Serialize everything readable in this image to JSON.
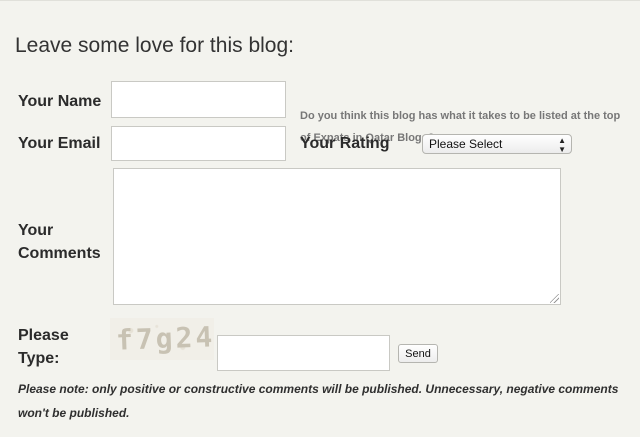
{
  "form": {
    "heading": "Leave some love for this blog:",
    "name": {
      "label": "Your Name",
      "value": ""
    },
    "email": {
      "label": "Your Email",
      "value": ""
    },
    "question": "Do you think this blog has what it takes to be listed at the top of Expats in Qatar Blogs?",
    "rating": {
      "label": "Your Rating",
      "selected": "Please Select"
    },
    "comments": {
      "label_line1": "Your",
      "label_line2": "Comments",
      "value": ""
    },
    "captcha": {
      "label_line1": "Please",
      "label_line2": "Type:",
      "code": "f7g24",
      "value": "",
      "send_label": "Send"
    },
    "note": "Please note: only positive or constructive comments will be published. Unnecessary, negative comments won't be published."
  },
  "colors": {
    "background": "#f3f3ee",
    "label": "#2b2b2b",
    "question": "#777777"
  },
  "icons": {
    "select_arrows": "select-arrows-icon",
    "resize": "resize-grip-icon"
  }
}
